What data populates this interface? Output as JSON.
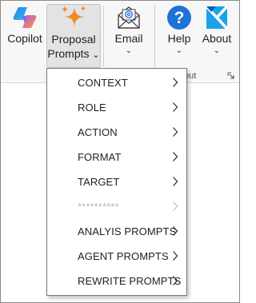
{
  "ribbon": {
    "copilot": {
      "label": "Copilot"
    },
    "proposal": {
      "line1": "Proposal",
      "line2": "Prompts",
      "caret": "⌄"
    },
    "email": {
      "label": "Email",
      "caret": "⌄"
    },
    "help": {
      "label": "Help",
      "caret": "⌄"
    },
    "about": {
      "label": "About",
      "caret": "⌄"
    },
    "group_label_fragment": "out"
  },
  "menu": {
    "items": [
      {
        "label": "CONTEXT",
        "enabled": true
      },
      {
        "label": "ROLE",
        "enabled": true
      },
      {
        "label": "ACTION",
        "enabled": true
      },
      {
        "label": "FORMAT",
        "enabled": true
      },
      {
        "label": "TARGET",
        "enabled": true
      },
      {
        "label": "**********",
        "enabled": false
      },
      {
        "label": "ANALYIS PROMPTS",
        "enabled": true
      },
      {
        "label": "AGENT PROMPTS",
        "enabled": true
      },
      {
        "label": "REWRITE PROMPTS",
        "enabled": true
      }
    ]
  },
  "icons": {
    "copilot": "copilot-logo-icon",
    "proposal": "sparkle-icon",
    "email": "envelope-at-icon",
    "help": "question-circle-icon",
    "about": "about-logo-icon",
    "launcher": "dialog-launcher-icon",
    "submenu": "chevron-right-icon"
  },
  "colors": {
    "sparkle": "#f08a24",
    "help_blue": "#1e73d6",
    "about_blue": "#1aa3e8",
    "menu_disabled": "#b8b8b8"
  }
}
